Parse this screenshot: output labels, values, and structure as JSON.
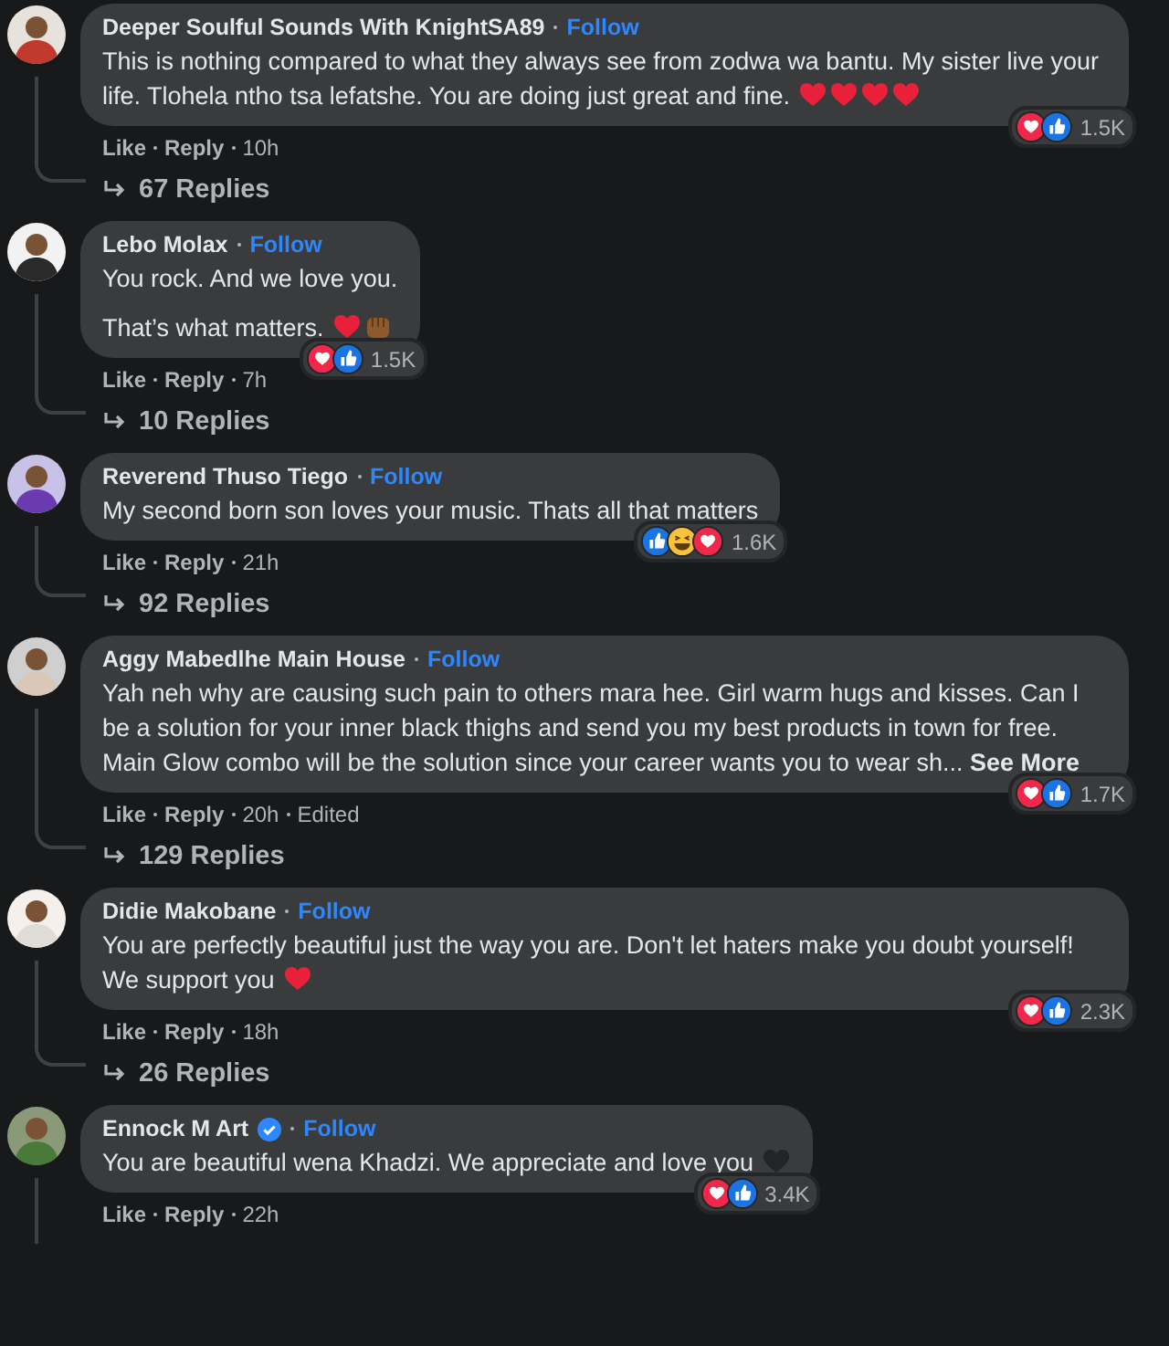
{
  "comments": [
    {
      "author": "Deeper Soulful Sounds With KnightSA89",
      "verified": false,
      "follow": "Follow",
      "paragraphs": [
        "This is nothing compared to what they always see from zodwa wa bantu. My sister live your life. Tlohela ntho tsa lefatshe. You are doing just great and fine."
      ],
      "emojis": [
        {
          "kind": "red_heart"
        },
        {
          "kind": "red_heart"
        },
        {
          "kind": "red_heart"
        },
        {
          "kind": "red_heart"
        }
      ],
      "reactions": [
        {
          "kind": "love"
        },
        {
          "kind": "like"
        }
      ],
      "reaction_count": "1.5K",
      "like": "Like",
      "reply": "Reply",
      "time": "10h",
      "replies": "67 Replies"
    },
    {
      "author": "Lebo Molax",
      "verified": false,
      "follow": "Follow",
      "paragraphs": [
        "You rock. And we love you.",
        "That’s what matters."
      ],
      "emojis": [
        {
          "kind": "red_heart"
        },
        {
          "kind": "fist"
        }
      ],
      "reactions": [
        {
          "kind": "love"
        },
        {
          "kind": "like"
        }
      ],
      "reaction_count": "1.5K",
      "like": "Like",
      "reply": "Reply",
      "time": "7h",
      "replies": "10 Replies"
    },
    {
      "author": "Reverend Thuso Tiego",
      "verified": false,
      "follow": "Follow",
      "paragraphs": [
        "My second born son loves your music. Thats all that matters"
      ],
      "reactions": [
        {
          "kind": "like"
        },
        {
          "kind": "haha"
        },
        {
          "kind": "love"
        }
      ],
      "reaction_count": "1.6K",
      "like": "Like",
      "reply": "Reply",
      "time": "21h",
      "replies": "92 Replies"
    },
    {
      "author": "Aggy Mabedlhe Main House",
      "verified": false,
      "follow": "Follow",
      "paragraphs": [
        "Yah neh why are causing such pain to others mara hee. Girl warm hugs and kisses. Can I be a solution for your inner black thighs and send you my best products in town for free. Main Glow combo will be the solution since your career wants you to wear sh..."
      ],
      "see_more": "See More",
      "reactions": [
        {
          "kind": "love"
        },
        {
          "kind": "like"
        }
      ],
      "reaction_count": "1.7K",
      "like": "Like",
      "reply": "Reply",
      "time": "20h",
      "edited": "Edited",
      "replies": "129 Replies"
    },
    {
      "author": "Didie Makobane",
      "verified": false,
      "follow": "Follow",
      "paragraphs": [
        "You are perfectly beautiful just the way you are. Don't let haters make you doubt yourself! We support you"
      ],
      "emojis": [
        {
          "kind": "red_heart"
        }
      ],
      "reactions": [
        {
          "kind": "love"
        },
        {
          "kind": "like"
        }
      ],
      "reaction_count": "2.3K",
      "like": "Like",
      "reply": "Reply",
      "time": "18h",
      "replies": "26 Replies"
    },
    {
      "author": "Ennock M Art",
      "verified": true,
      "follow": "Follow",
      "paragraphs": [
        "You are beautiful wena Khadzi. We appreciate and love you"
      ],
      "emojis": [
        {
          "kind": "black_heart"
        }
      ],
      "reactions": [
        {
          "kind": "love"
        },
        {
          "kind": "like"
        }
      ],
      "reaction_count": "3.4K",
      "like": "Like",
      "reply": "Reply",
      "time": "22h"
    }
  ]
}
